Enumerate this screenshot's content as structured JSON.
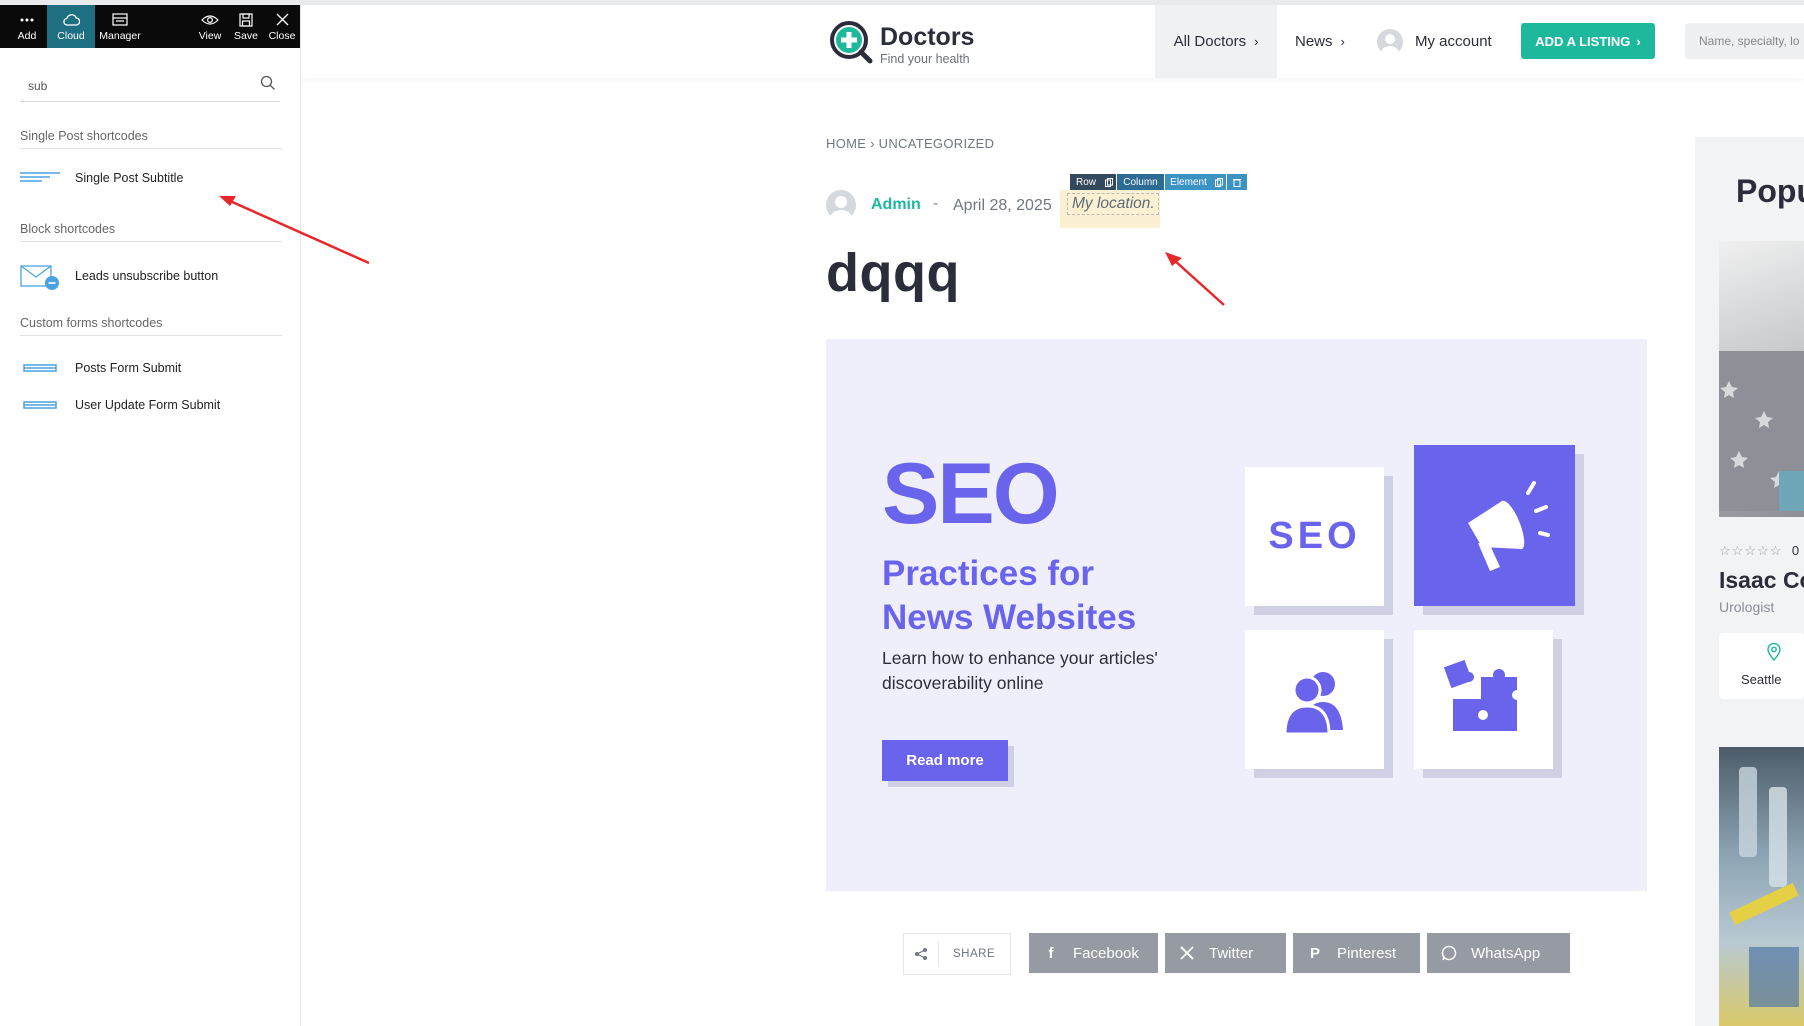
{
  "builder": {
    "toolbar": {
      "add": "Add",
      "cloud": "Cloud",
      "manager": "Manager",
      "view": "View",
      "save": "Save",
      "close": "Close"
    },
    "search_value": "sub",
    "sections": [
      {
        "title": "Single Post shortcodes",
        "items": [
          {
            "label": "Single Post Subtitle",
            "icon": "subtitle-lines-icon"
          }
        ]
      },
      {
        "title": "Block shortcodes",
        "items": [
          {
            "label": "Leads unsubscribe button",
            "icon": "mail-unsubscribe-icon"
          }
        ]
      },
      {
        "title": "Custom forms shortcodes",
        "items": [
          {
            "label": "Posts Form Submit",
            "icon": "form-submit-icon"
          },
          {
            "label": "User Update Form Submit",
            "icon": "form-submit-icon"
          }
        ]
      }
    ],
    "element_bar": {
      "row": "Row",
      "column": "Column",
      "element": "Element"
    }
  },
  "header": {
    "logo_name": "Doctors",
    "logo_tagline": "Find your health",
    "nav": {
      "all_doctors": "All Doctors",
      "news": "News",
      "my_account": "My account"
    },
    "add_listing": "ADD A LISTING",
    "search_placeholder": "Name, specialty, lo",
    "accent": "#1eb99c"
  },
  "post": {
    "breadcrumb": "HOME › UNCATEGORIZED",
    "author": "Admin",
    "separator": "-",
    "date": "April 28, 2025",
    "location": "My location.",
    "title": "dqqq",
    "hero": {
      "heading": "SEO",
      "subheading_line1": "Practices for",
      "subheading_line2": "News Websites",
      "desc_line1": "Learn how to enhance your articles'",
      "desc_line2": "discoverability online",
      "button": "Read more",
      "tile_text": "SEO",
      "accent": "#6a63ec"
    },
    "share": {
      "label": "SHARE",
      "buttons": [
        "Facebook",
        "Twitter",
        "Pinterest",
        "WhatsApp"
      ]
    }
  },
  "sidebar": {
    "title": "Popu",
    "rating_count": "0",
    "doctor_name": "Isaac Co",
    "specialty": "Urologist",
    "city": "Seattle"
  }
}
